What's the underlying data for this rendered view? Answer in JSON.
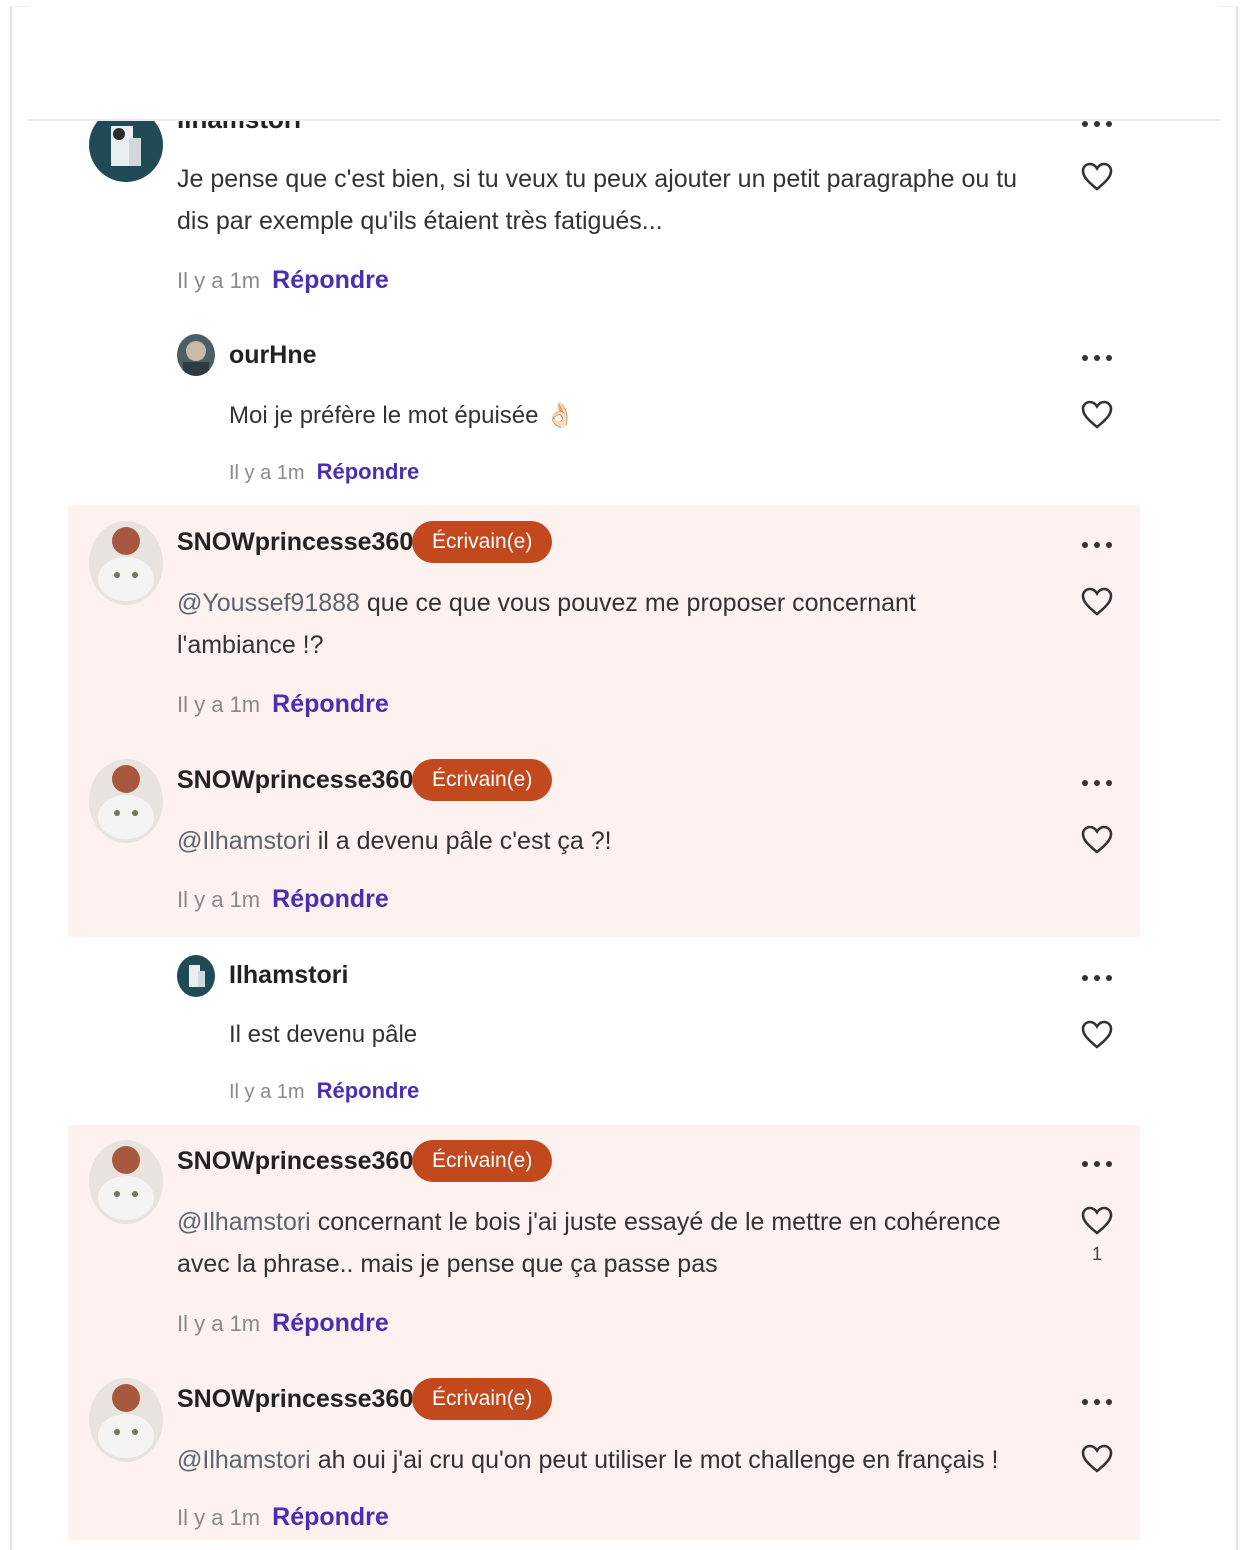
{
  "comments": [
    {
      "username": "Ilhamstori",
      "text": "Je pense que c'est bien, si tu veux tu peux ajouter un petit paragraphe ou tu dis par exemple qu'ils étaient très fatigués...",
      "time": "Il y a 1m",
      "reply": "Répondre"
    },
    {
      "username": "ourHne",
      "text": "Moi je préfère le mot épuisée 👌🏻",
      "time": "Il y a 1m",
      "reply": "Répondre"
    },
    {
      "username": "SNOWprincesse360",
      "badge": "Écrivain(e)",
      "mention": "@Youssef91888",
      "text": " que ce que vous pouvez me proposer concernant l'ambiance !?",
      "time": "Il y a 1m",
      "reply": "Répondre"
    },
    {
      "username": "SNOWprincesse360",
      "badge": "Écrivain(e)",
      "mention": "@Ilhamstori",
      "text": " il a devenu pâle c'est ça ?!",
      "time": "Il y a 1m",
      "reply": "Répondre"
    },
    {
      "username": "Ilhamstori",
      "text": "Il est devenu pâle",
      "time": "Il y a 1m",
      "reply": "Répondre"
    },
    {
      "username": "SNOWprincesse360",
      "badge": "Écrivain(e)",
      "mention": "@Ilhamstori",
      "text": " concernant le bois j'ai juste essayé de le mettre en cohérence avec la phrase.. mais je pense que ça passe pas",
      "time": "Il y a 1m",
      "reply": "Répondre",
      "likes": "1"
    },
    {
      "username": "SNOWprincesse360",
      "badge": "Écrivain(e)",
      "mention": "@Ilhamstori",
      "text": " ah oui j'ai cru qu'on peut utiliser le mot challenge en français !",
      "time": "Il y a 1m",
      "reply": "Répondre"
    }
  ],
  "colors": {
    "accent_reply": "#4b2fb0",
    "badge_bg": "#c2491d",
    "highlight_bg": "#fdf2ef"
  }
}
